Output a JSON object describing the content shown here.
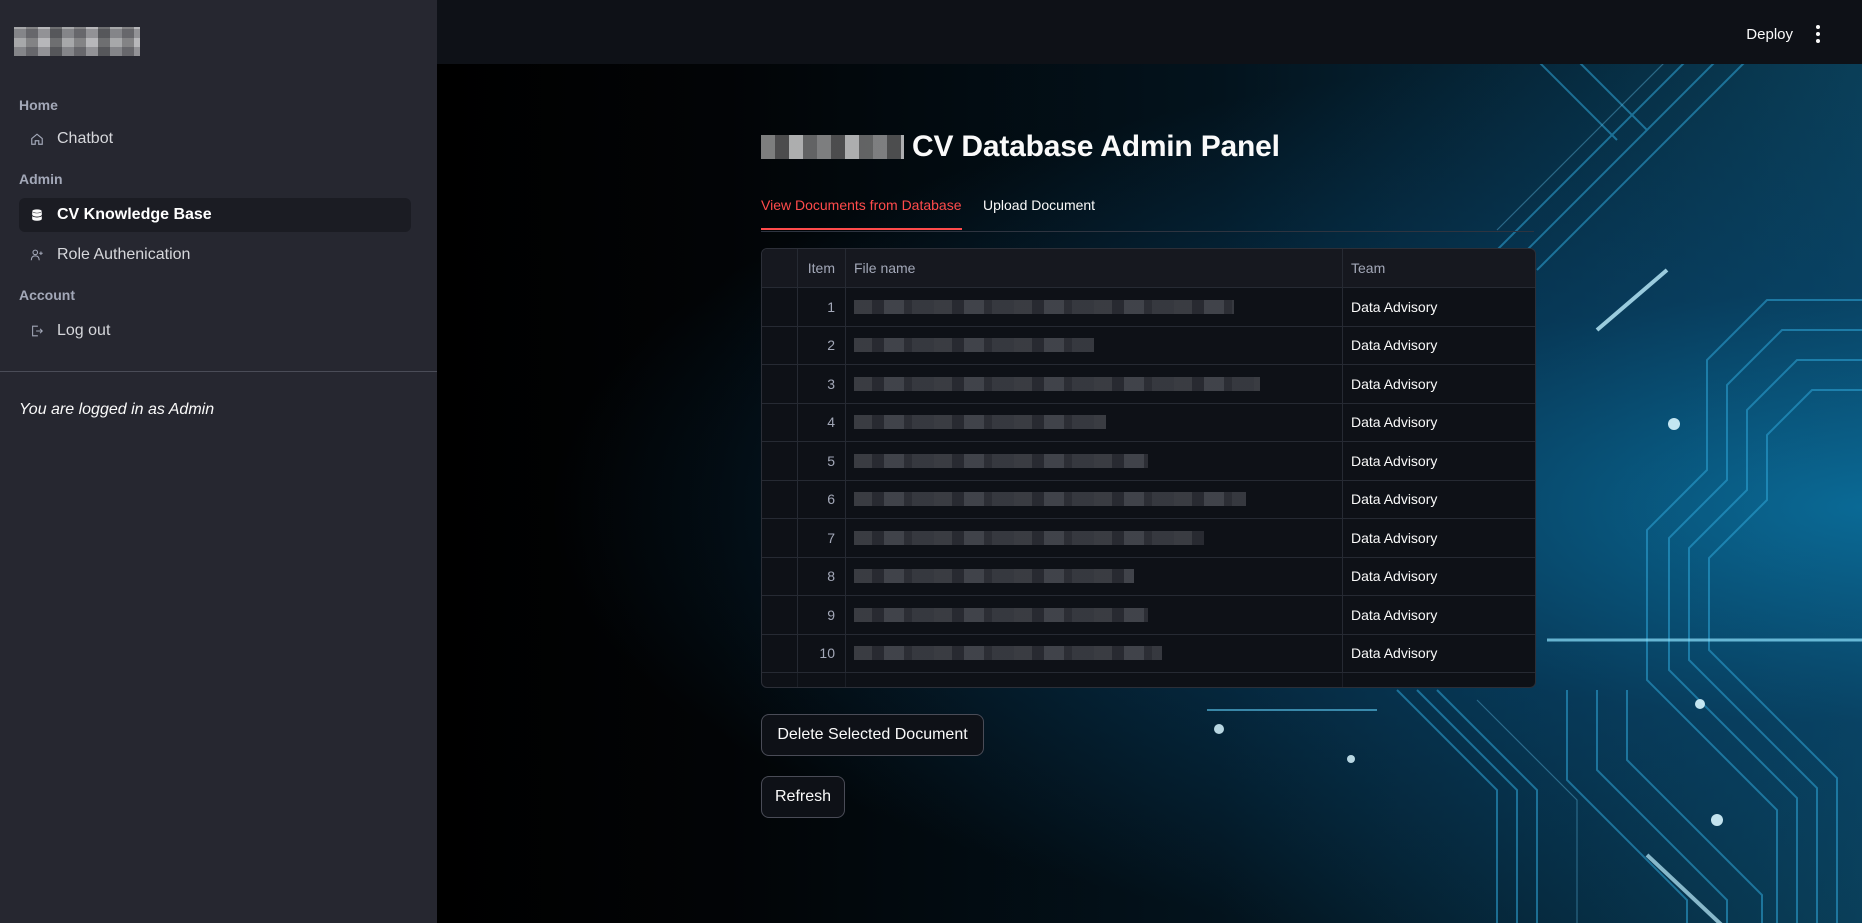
{
  "sidebar": {
    "sections": [
      {
        "label": "Home",
        "items": [
          {
            "label": "Chatbot",
            "icon": "home-icon"
          }
        ]
      },
      {
        "label": "Admin",
        "items": [
          {
            "label": "CV Knowledge Base",
            "icon": "database-icon",
            "active": true
          },
          {
            "label": "Role Authenication",
            "icon": "user-add-icon"
          }
        ]
      },
      {
        "label": "Account",
        "items": [
          {
            "label": "Log out",
            "icon": "logout-icon"
          }
        ]
      }
    ],
    "status_text": "You are logged in as Admin"
  },
  "topbar": {
    "deploy_label": "Deploy"
  },
  "main": {
    "title": "CV Database Admin Panel",
    "tabs": [
      {
        "label": "View Documents from Database",
        "active": true
      },
      {
        "label": "Upload Document",
        "active": false
      }
    ],
    "table": {
      "columns": [
        "Item",
        "File name",
        "Team"
      ],
      "rows": [
        {
          "item": "1",
          "team": "Data Advisory"
        },
        {
          "item": "2",
          "team": "Data Advisory"
        },
        {
          "item": "3",
          "team": "Data Advisory"
        },
        {
          "item": "4",
          "team": "Data Advisory"
        },
        {
          "item": "5",
          "team": "Data Advisory"
        },
        {
          "item": "6",
          "team": "Data Advisory"
        },
        {
          "item": "7",
          "team": "Data Advisory"
        },
        {
          "item": "8",
          "team": "Data Advisory"
        },
        {
          "item": "9",
          "team": "Data Advisory"
        },
        {
          "item": "10",
          "team": "Data Advisory"
        }
      ]
    },
    "buttons": {
      "delete_label": "Delete Selected Document",
      "refresh_label": "Refresh"
    }
  },
  "colors": {
    "accent": "#ff4b4b",
    "sidebar_bg": "#262730",
    "app_bg": "#0e1117"
  }
}
